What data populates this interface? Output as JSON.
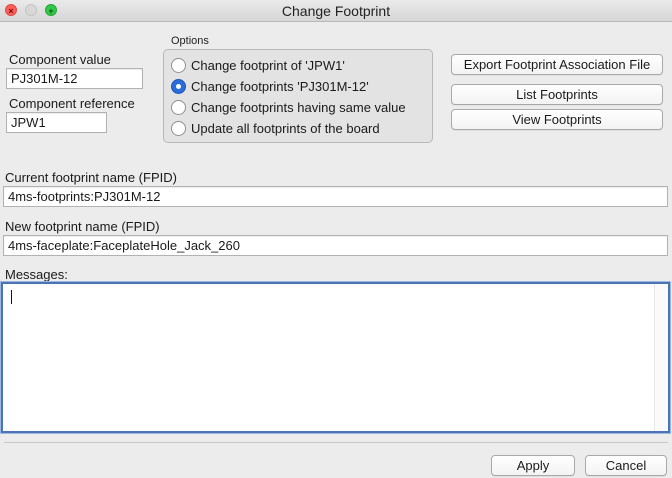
{
  "window": {
    "title": "Change Footprint"
  },
  "component": {
    "value_label": "Component value",
    "value": "PJ301M-12",
    "reference_label": "Component reference",
    "reference": "JPW1"
  },
  "options": {
    "title": "Options",
    "items": [
      {
        "label": "Change footprint of 'JPW1'",
        "checked": false
      },
      {
        "label": "Change footprints 'PJ301M-12'",
        "checked": true
      },
      {
        "label": "Change footprints having same value",
        "checked": false
      },
      {
        "label": "Update all footprints of the board",
        "checked": false
      }
    ]
  },
  "actions": {
    "export": "Export Footprint Association File",
    "list": "List Footprints",
    "view": "View Footprints"
  },
  "fpid": {
    "current_label": "Current footprint name (FPID)",
    "current_value": "4ms-footprints:PJ301M-12",
    "new_label": "New footprint name (FPID)",
    "new_value": "4ms-faceplate:FaceplateHole_Jack_260"
  },
  "messages": {
    "label": "Messages:",
    "content": ""
  },
  "footer": {
    "apply": "Apply",
    "cancel": "Cancel"
  },
  "colors": {
    "radio_selected": "#2a6dd9",
    "focus_ring": "#4a74b5"
  }
}
